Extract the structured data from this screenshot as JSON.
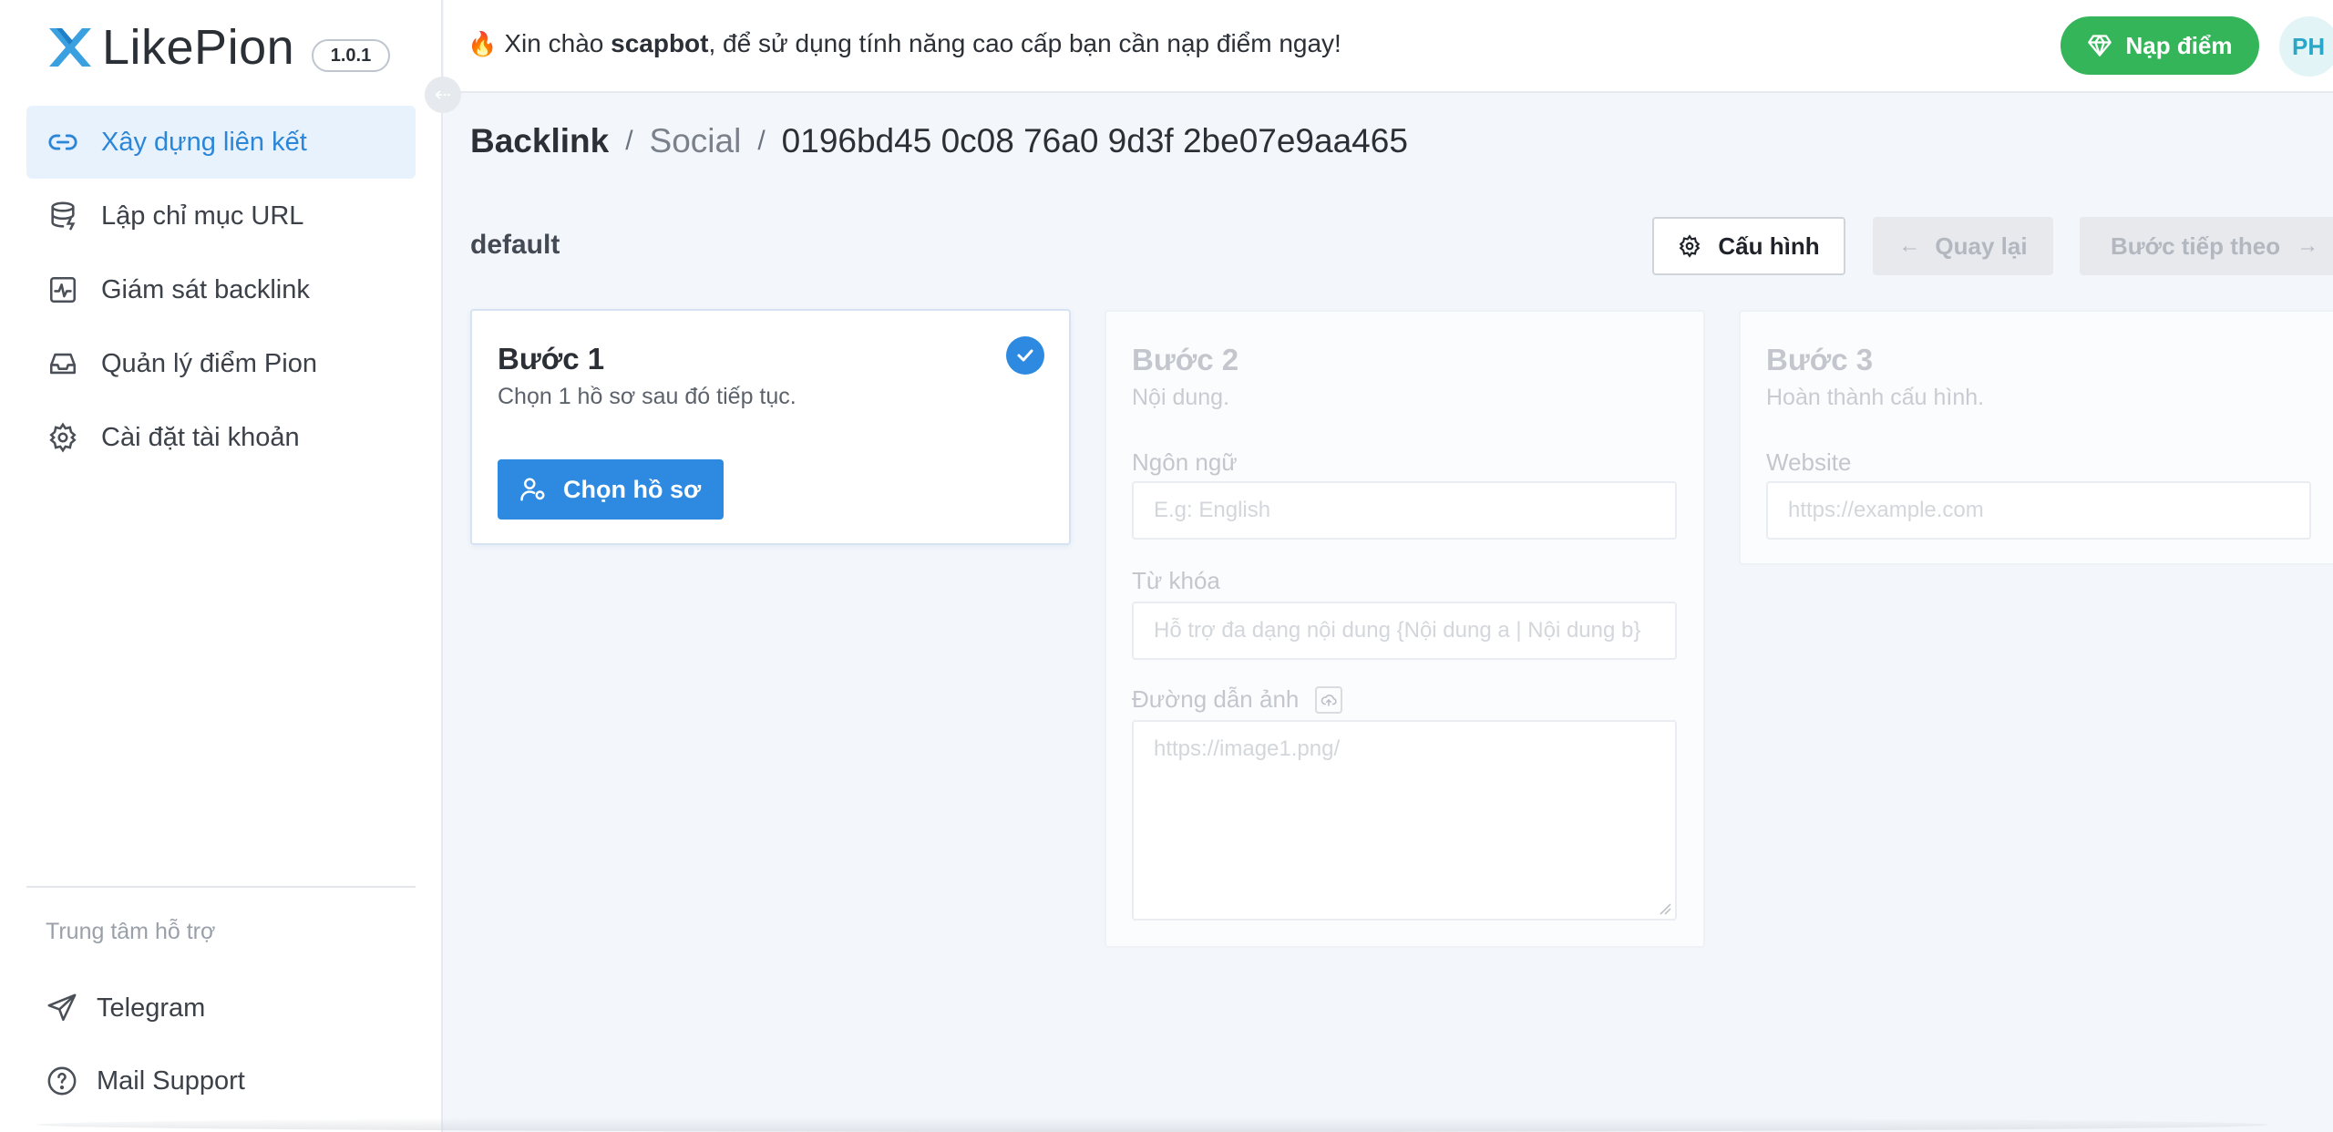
{
  "app": {
    "name": "LikePion",
    "version": "1.0.1"
  },
  "sidebar": {
    "items": [
      {
        "label": "Xây dựng liên kết",
        "icon": "link-icon",
        "active": true
      },
      {
        "label": "Lập chỉ mục URL",
        "icon": "database-icon",
        "active": false
      },
      {
        "label": "Giám sát backlink",
        "icon": "activity-icon",
        "active": false
      },
      {
        "label": "Quản lý điểm Pion",
        "icon": "inbox-icon",
        "active": false
      },
      {
        "label": "Cài đặt tài khoản",
        "icon": "gear-icon",
        "active": false
      }
    ],
    "support_title": "Trung tâm hỗ trợ",
    "support_items": [
      {
        "label": "Telegram",
        "icon": "send-icon"
      },
      {
        "label": "Mail Support",
        "icon": "help-circle-icon"
      }
    ]
  },
  "header": {
    "greeting_prefix": "Xin chào",
    "username": "scapbot",
    "greeting_suffix": ", để sử dụng tính năng cao cấp bạn cần nạp điểm ngay!",
    "topup_label": "Nạp điểm",
    "avatar_initials": "PH"
  },
  "breadcrumb": {
    "root": "Backlink",
    "middle": "Social",
    "current": "0196bd45 0c08 76a0 9d3f 2be07e9aa465",
    "separator": "/"
  },
  "toolbar": {
    "profile_name": "default",
    "config_label": "Cấu hình",
    "back_label": "Quay lại",
    "next_label": "Bước tiếp theo"
  },
  "steps": [
    {
      "title": "Bước 1",
      "subtitle": "Chọn 1 hồ sơ sau đó tiếp tục.",
      "completed": true,
      "button_label": "Chọn hồ sơ"
    },
    {
      "title": "Bước 2",
      "subtitle": "Nội dung.",
      "fields": {
        "language_label": "Ngôn ngữ",
        "language_placeholder": "E.g: English",
        "keyword_label": "Từ khóa",
        "keyword_placeholder": "Hỗ trợ đa dạng nội dung {Nội dung a | Nội dung b}",
        "image_label": "Đường dẫn ảnh",
        "image_placeholder": "https://image1.png/"
      }
    },
    {
      "title": "Bước 3",
      "subtitle": "Hoàn thành cấu hình.",
      "fields": {
        "website_label": "Website",
        "website_placeholder": "https://example.com"
      }
    }
  ],
  "colors": {
    "primary": "#2d8ae0",
    "success": "#34b55a",
    "active_bg": "#e8f2fd",
    "background": "#f3f7fc"
  }
}
